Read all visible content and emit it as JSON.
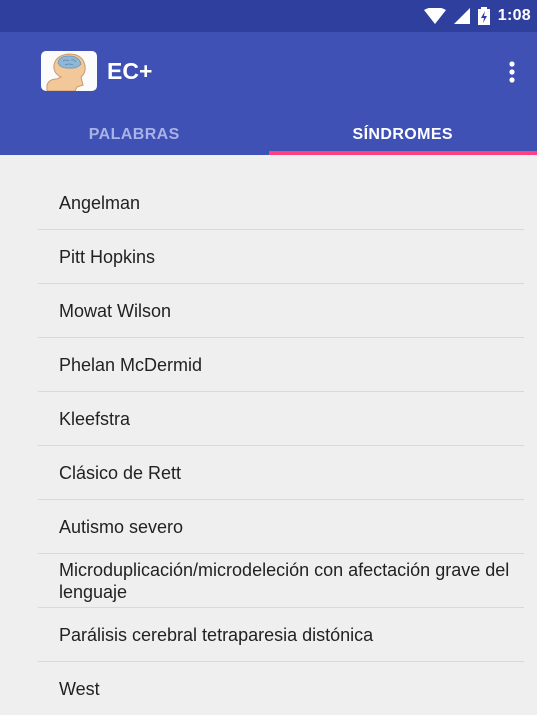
{
  "status_bar": {
    "time": "1:08",
    "icons": [
      "wifi-icon",
      "signal-icon",
      "battery-icon"
    ]
  },
  "app_bar": {
    "title": "EC+",
    "logo_icon": "head-brain-logo",
    "menu_icon": "more-vert-icon",
    "color": "#3f51b5",
    "status_color": "#2f3f9e"
  },
  "tabs": [
    {
      "label": "PALABRAS",
      "active": false
    },
    {
      "label": "SÍNDROMES",
      "active": true
    }
  ],
  "accent_color": "#ff4081",
  "list": {
    "items": [
      "Angelman",
      "Pitt Hopkins",
      "Mowat Wilson",
      "Phelan McDermid",
      "Kleefstra",
      "Clásico de Rett",
      "Autismo severo",
      "Microduplicación/microdeleción con afectación grave del lenguaje",
      "Parálisis cerebral tetraparesia distónica",
      "West"
    ]
  }
}
